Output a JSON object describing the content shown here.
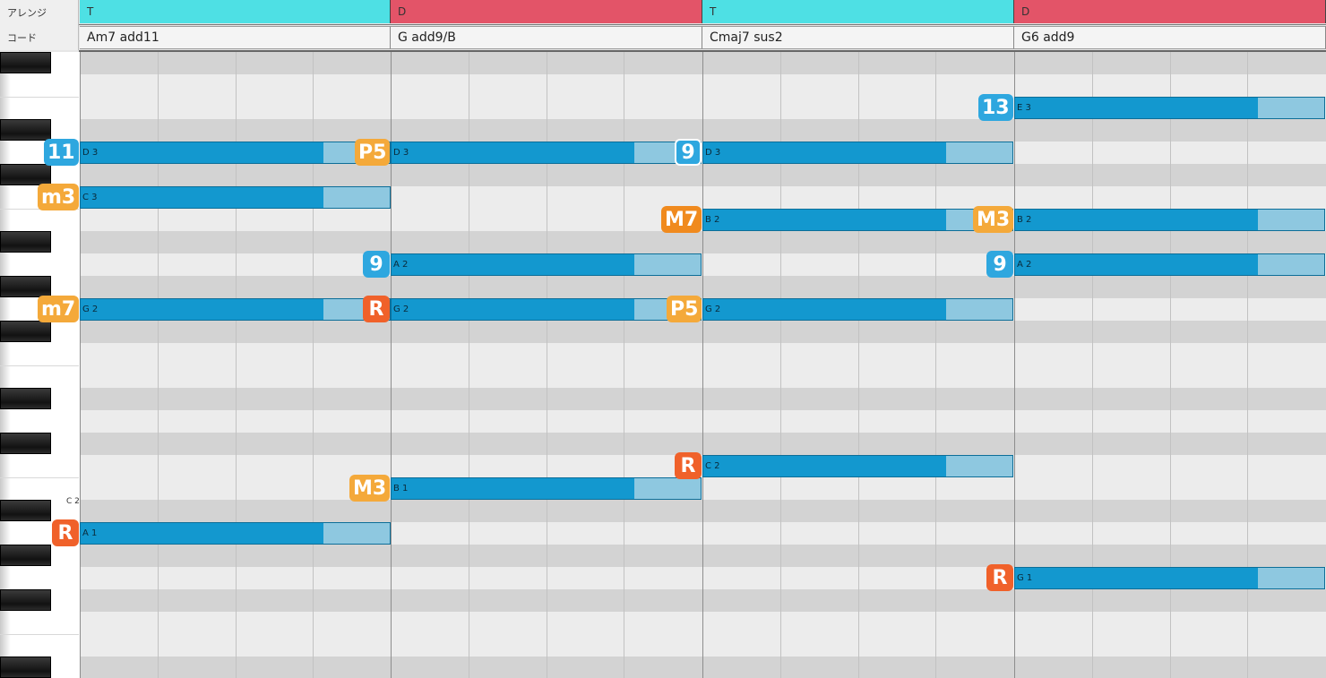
{
  "header": {
    "arrange_label": "アレンジ",
    "chord_label": "コード",
    "arrange": [
      {
        "label": "T",
        "color": "#4ee0e4"
      },
      {
        "label": "D",
        "color": "#e35468"
      },
      {
        "label": "T",
        "color": "#4ee0e4"
      },
      {
        "label": "D",
        "color": "#e35468"
      }
    ],
    "chords": [
      "Am7 add11",
      "G add9/B",
      "Cmaj7 sus2",
      "G6 add9"
    ]
  },
  "keyboard": {
    "octave_label": "C 2"
  },
  "notes": [
    {
      "label": "D 3",
      "pitch": 50,
      "bar": 1
    },
    {
      "label": "C 3",
      "pitch": 48,
      "bar": 1
    },
    {
      "label": "G 2",
      "pitch": 43,
      "bar": 1
    },
    {
      "label": "A 1",
      "pitch": 33,
      "bar": 1
    },
    {
      "label": "D 3",
      "pitch": 50,
      "bar": 2
    },
    {
      "label": "A 2",
      "pitch": 45,
      "bar": 2
    },
    {
      "label": "G 2",
      "pitch": 43,
      "bar": 2
    },
    {
      "label": "B 1",
      "pitch": 35,
      "bar": 2
    },
    {
      "label": "D 3",
      "pitch": 50,
      "bar": 3
    },
    {
      "label": "B 2",
      "pitch": 47,
      "bar": 3
    },
    {
      "label": "G 2",
      "pitch": 43,
      "bar": 3
    },
    {
      "label": "C 2",
      "pitch": 36,
      "bar": 3
    },
    {
      "label": "E 3",
      "pitch": 52,
      "bar": 4
    },
    {
      "label": "B 2",
      "pitch": 47,
      "bar": 4
    },
    {
      "label": "A 2",
      "pitch": 45,
      "bar": 4
    },
    {
      "label": "G 1",
      "pitch": 31,
      "bar": 4
    }
  ],
  "badges": [
    {
      "text": "11",
      "pitch": 50,
      "bar": 1,
      "color": "#2ea7df"
    },
    {
      "text": "m3",
      "pitch": 48,
      "bar": 1,
      "color": "#f4a93a"
    },
    {
      "text": "m7",
      "pitch": 43,
      "bar": 1,
      "color": "#f4a93a"
    },
    {
      "text": "R",
      "pitch": 33,
      "bar": 1,
      "color": "#f0612a"
    },
    {
      "text": "P5",
      "pitch": 50,
      "bar": 2,
      "color": "#f4a93a"
    },
    {
      "text": "9",
      "pitch": 45,
      "bar": 2,
      "color": "#2ea7df"
    },
    {
      "text": "R",
      "pitch": 43,
      "bar": 2,
      "color": "#f0612a"
    },
    {
      "text": "M3",
      "pitch": 35,
      "bar": 2,
      "color": "#f4a93a"
    },
    {
      "text": "9",
      "pitch": 50,
      "bar": 3,
      "color": "#2ea7df",
      "outlined": true
    },
    {
      "text": "M7",
      "pitch": 47,
      "bar": 3,
      "color": "#f08a1e"
    },
    {
      "text": "P5",
      "pitch": 43,
      "bar": 3,
      "color": "#f4a93a"
    },
    {
      "text": "R",
      "pitch": 36,
      "bar": 3,
      "color": "#f0612a"
    },
    {
      "text": "13",
      "pitch": 52,
      "bar": 4,
      "color": "#2ea7df"
    },
    {
      "text": "M3",
      "pitch": 47,
      "bar": 4,
      "color": "#f4a93a"
    },
    {
      "text": "9",
      "pitch": 45,
      "bar": 4,
      "color": "#2ea7df"
    },
    {
      "text": "R",
      "pitch": 31,
      "bar": 4,
      "color": "#f0612a"
    }
  ]
}
